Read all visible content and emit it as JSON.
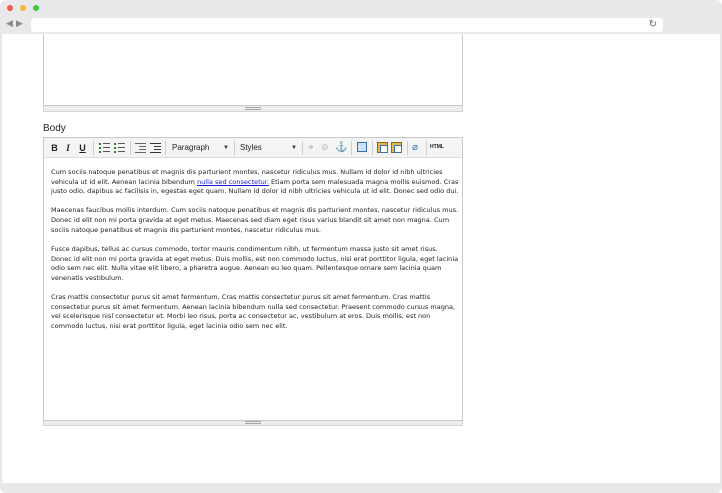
{
  "browser": {
    "back_icon": "back-arrow-icon",
    "forward_icon": "forward-arrow-icon",
    "reload_icon": "reload-icon",
    "address_value": "",
    "colors": {
      "close": "#f35a50",
      "minimize": "#f5b93b",
      "zoom": "#45c546"
    }
  },
  "form": {
    "body_label": "Body"
  },
  "toolbar": {
    "bold": "B",
    "italic": "I",
    "underline": "U",
    "format_select": "Paragraph",
    "styles_select": "Styles",
    "html_button": "HTML"
  },
  "content": {
    "paragraphs": [
      {
        "before": "Cum sociis natoque penatibus et magnis dis parturient montes, nascetur ridiculus mus. Nullam id dolor id nibh ultricies vehicula ut id elit. Aenean lacinia bibendum ",
        "link": "nulla sed consectetur.",
        "after": " Etiam porta sem malesuada magna mollis euismod. Cras justo odio, dapibus ac facilisis in, egestas eget quam. Nullam id dolor id nibh ultricies vehicula ut id elit. Donec sed odio dui."
      },
      {
        "text": "Maecenas faucibus mollis interdum. Cum sociis natoque penatibus et magnis dis parturient montes, nascetur ridiculus mus. Donec id elit non mi porta gravida at eget metus. Maecenas sed diam eget risus varius blandit sit amet non magna. Cum sociis natoque penatibus et magnis dis parturient montes, nascetur ridiculus mus."
      },
      {
        "text": "Fusce dapibus, tellus ac cursus commodo, tortor mauris condimentum nibh, ut fermentum massa justo sit amet risus. Donec id elit non mi porta gravida at eget metus. Duis mollis, est non commodo luctus, nisi erat porttitor ligula, eget lacinia odio sem nec elit. Nulla vitae elit libero, a pharetra augue. Aenean eu leo quam. Pellentesque ornare sem lacinia quam venenatis vestibulum."
      },
      {
        "text": "Cras mattis consectetur purus sit amet fermentum. Cras mattis consectetur purus sit amet fermentum. Cras mattis consectetur purus sit amet fermentum. Aenean lacinia bibendum nulla sed consectetur. Praesent commodo cursus magna, vel scelerisque nisl consectetur et. Morbi leo risus, porta ac consectetur ac, vestibulum at eros. Duis mollis, est non commodo luctus, nisi erat porttitor ligula, eget lacinia odio sem nec elit."
      }
    ]
  }
}
